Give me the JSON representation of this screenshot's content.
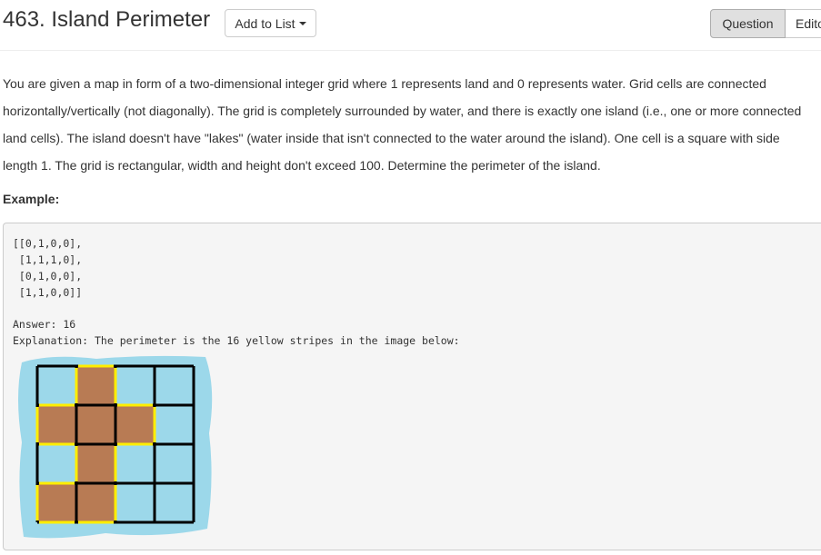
{
  "header": {
    "title": "463. Island Perimeter",
    "add_to_list": "Add to List",
    "tabs": [
      "Question",
      "Editorial"
    ]
  },
  "description": "You are given a map in form of a two-dimensional integer grid where 1 represents land and 0 represents water. Grid cells are connected horizontally/vertically (not diagonally). The grid is completely surrounded by water, and there is exactly one island (i.e., one or more connected land cells). The island doesn't have \"lakes\" (water inside that isn't connected to the water around the island). One cell is a square with side length 1. The grid is rectangular, width and height don't exceed 100. Determine the perimeter of the island.",
  "example": {
    "label": "Example:",
    "grid_lines": [
      "[[0,1,0,0],",
      " [1,1,1,0],",
      " [0,1,0,0],",
      " [1,1,0,0]]"
    ],
    "answer": "Answer: 16",
    "explanation": "Explanation: The perimeter is the 16 yellow stripes in the image below:",
    "grid": [
      [
        0,
        1,
        0,
        0
      ],
      [
        1,
        1,
        1,
        0
      ],
      [
        0,
        1,
        0,
        0
      ],
      [
        1,
        1,
        0,
        0
      ]
    ],
    "colors": {
      "land": "#b87b54",
      "water": "#9cd8ea",
      "stripe": "#ffee00",
      "line": "#000000"
    }
  }
}
